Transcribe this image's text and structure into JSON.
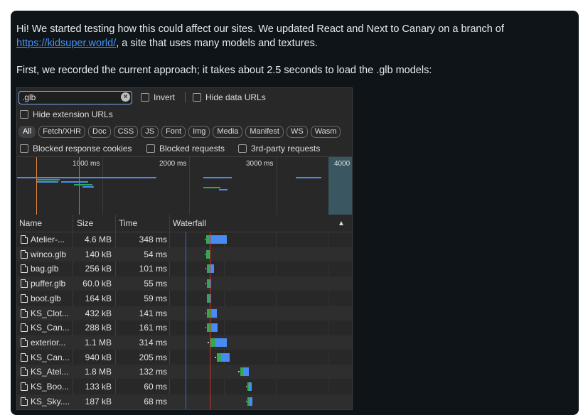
{
  "message": {
    "line1_start": "Hi! We started testing how this could affect our sites. We updated React and Next to Canary on a branch of",
    "link_text": "https://kidsuper.world/",
    "line2_rest": ", a site that uses many models and textures.",
    "line3": "First, we recorded the current approach; it takes about 2.5 seconds to load the .glb models:"
  },
  "devtools": {
    "filter": {
      "value": ".glb",
      "clear_icon": "×"
    },
    "checkboxes": {
      "invert": "Invert",
      "hide_data_urls": "Hide data URLs",
      "hide_extension_urls": "Hide extension URLs",
      "blocked_cookies": "Blocked response cookies",
      "blocked_requests": "Blocked requests",
      "third_party": "3rd-party requests"
    },
    "type_filters": [
      "All",
      "Fetch/XHR",
      "Doc",
      "CSS",
      "JS",
      "Font",
      "Img",
      "Media",
      "Manifest",
      "WS",
      "Wasm"
    ],
    "overview_labels": [
      "1000 ms",
      "2000 ms",
      "3000 ms",
      "4000"
    ],
    "columns": {
      "name": "Name",
      "size": "Size",
      "time": "Time",
      "waterfall": "Waterfall",
      "sort_icon": "▲"
    },
    "rows": [
      {
        "name": "Atelier-...",
        "size": "4.6 MB",
        "time": "348 ms"
      },
      {
        "name": "winco.glb",
        "size": "140 kB",
        "time": "54 ms"
      },
      {
        "name": "bag.glb",
        "size": "256 kB",
        "time": "101 ms"
      },
      {
        "name": "puffer.glb",
        "size": "60.0 kB",
        "time": "55 ms"
      },
      {
        "name": "boot.glb",
        "size": "164 kB",
        "time": "59 ms"
      },
      {
        "name": "KS_Clot...",
        "size": "432 kB",
        "time": "141 ms"
      },
      {
        "name": "KS_Can...",
        "size": "288 kB",
        "time": "161 ms"
      },
      {
        "name": "exterior...",
        "size": "1.1 MB",
        "time": "314 ms"
      },
      {
        "name": "KS_Can...",
        "size": "940 kB",
        "time": "205 ms"
      },
      {
        "name": "KS_Atel...",
        "size": "1.8 MB",
        "time": "132 ms"
      },
      {
        "name": "KS_Boo...",
        "size": "133 kB",
        "time": "60 ms"
      },
      {
        "name": "KS_Sky....",
        "size": "187 kB",
        "time": "68 ms"
      }
    ],
    "colors": {
      "dom_content_loaded": "#2f6fd6",
      "load": "#d93025",
      "waiting": "#33a853",
      "download": "#4a8af4"
    }
  }
}
